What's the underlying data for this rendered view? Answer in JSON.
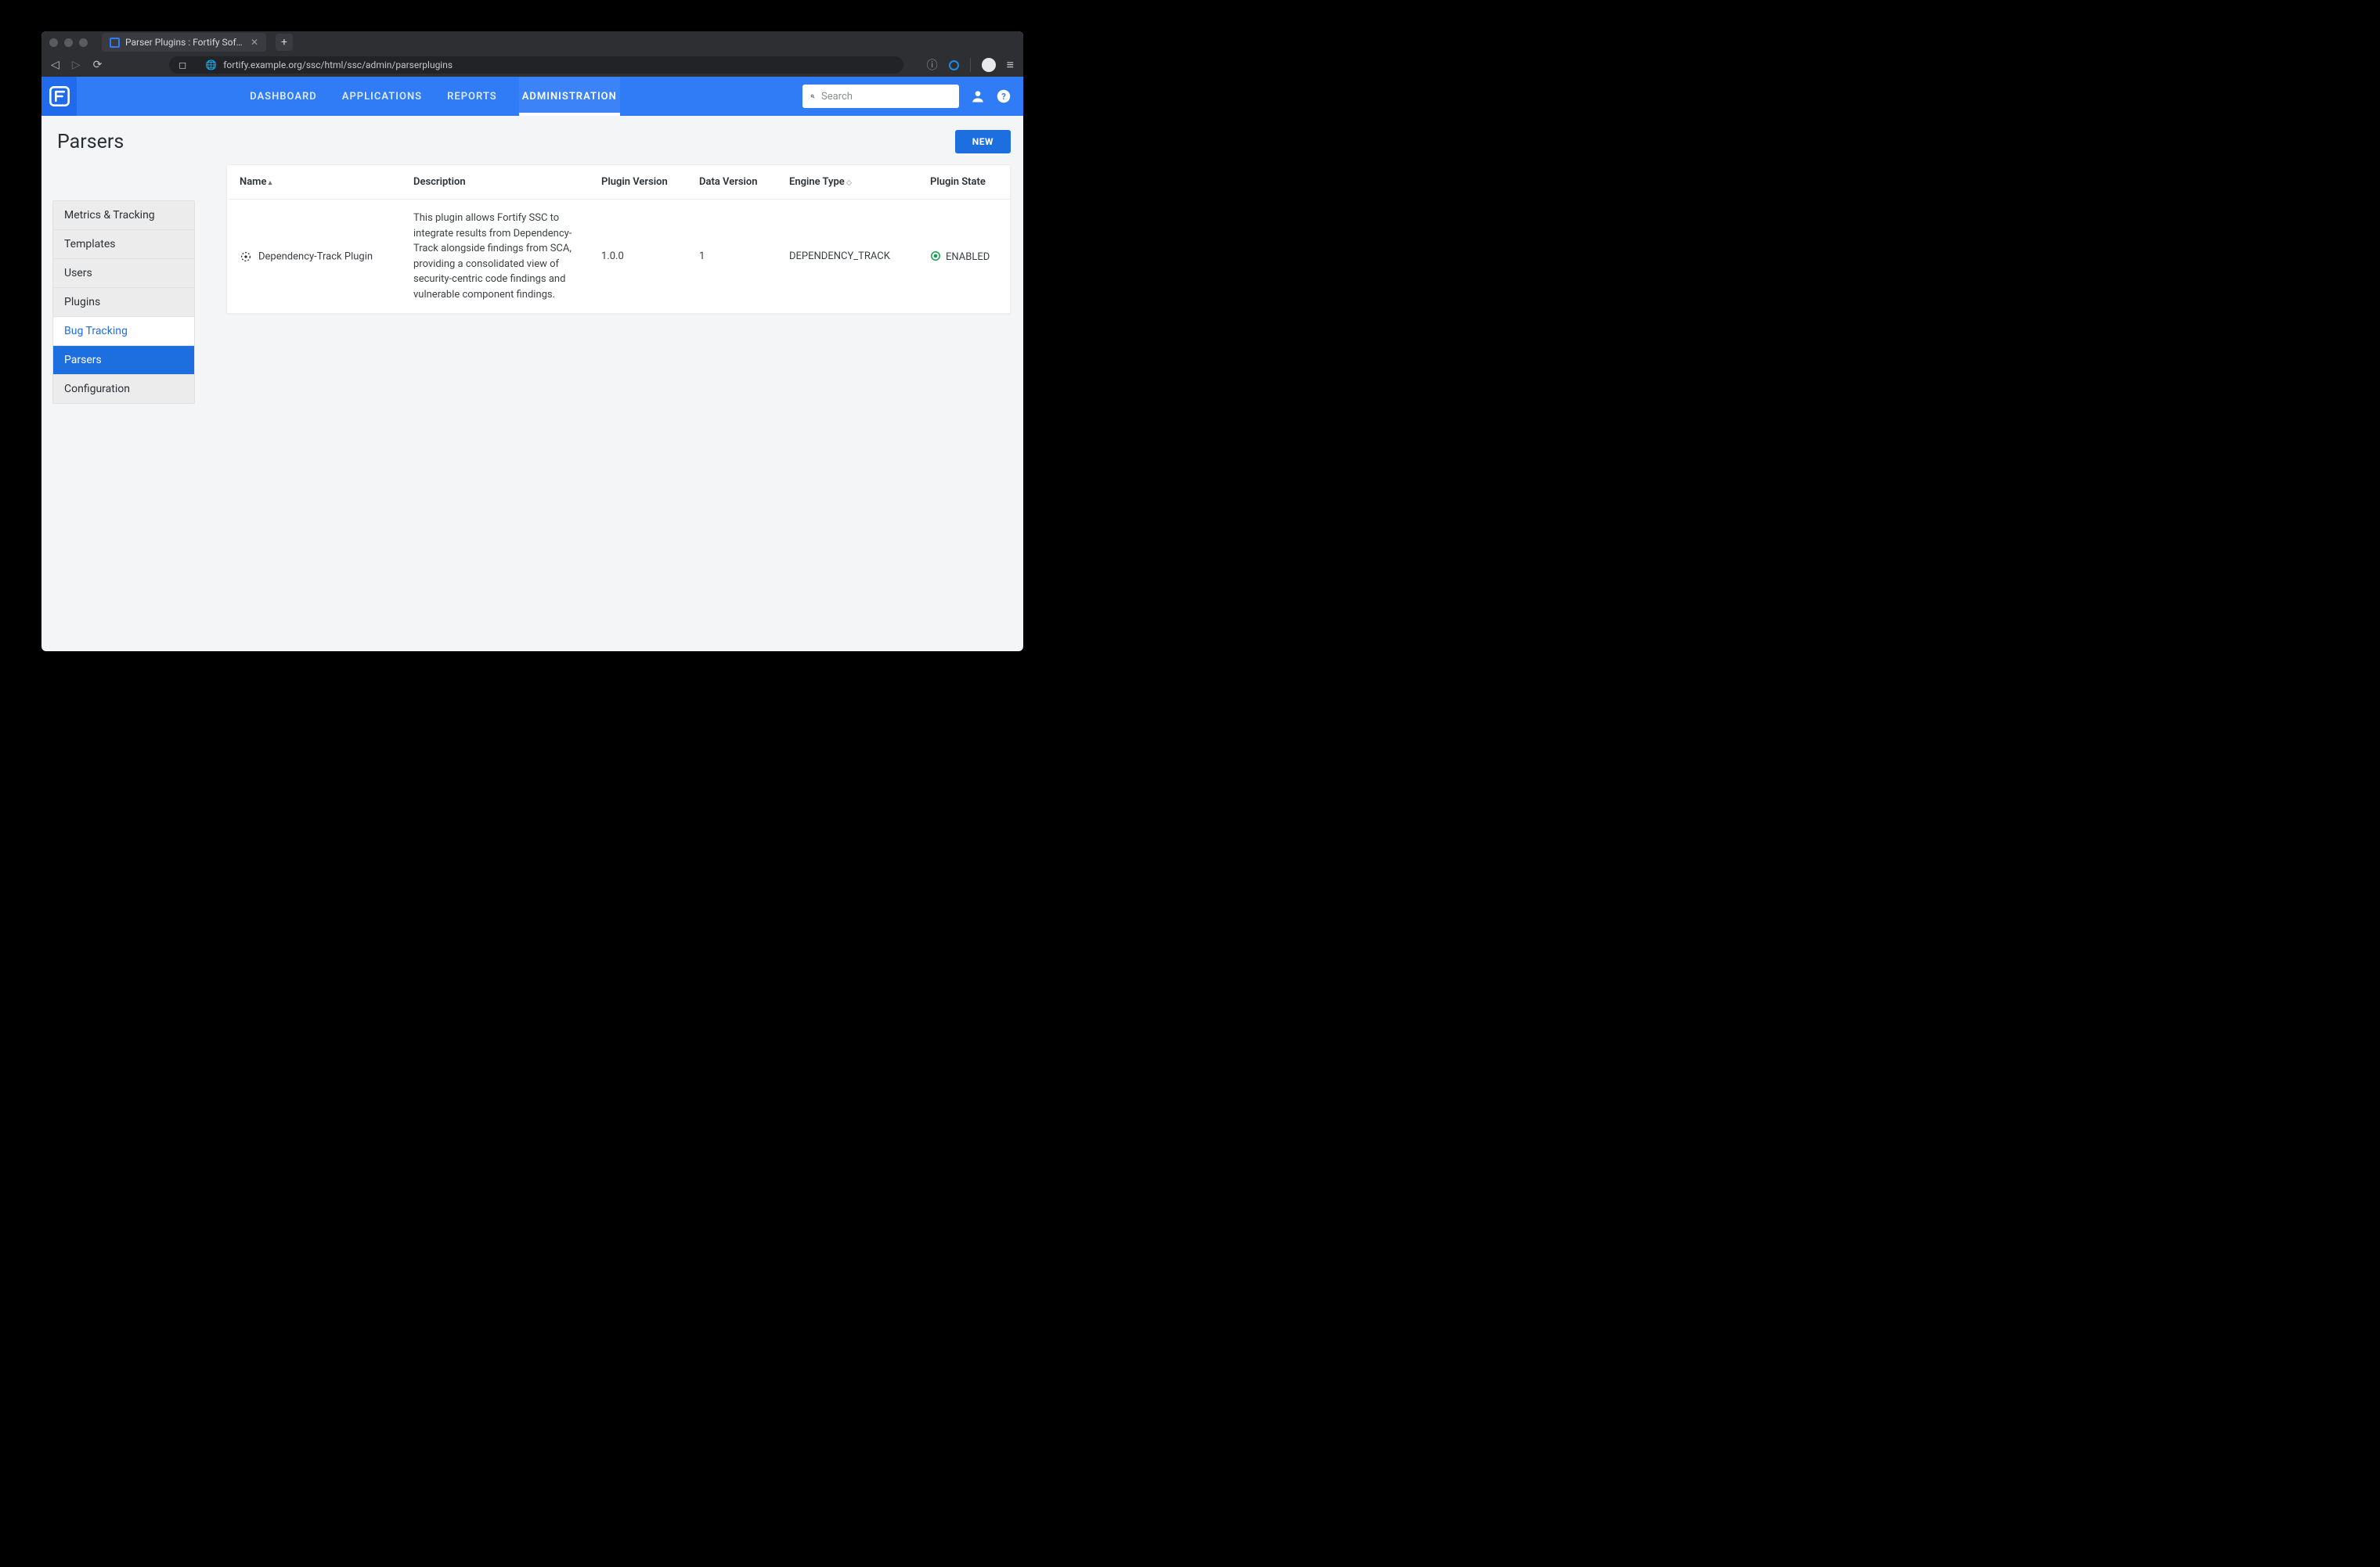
{
  "browser": {
    "tab_title": "Parser Plugins : Fortify Software",
    "url": "fortify.example.org/ssc/html/ssc/admin/parserplugins"
  },
  "header": {
    "nav": {
      "dashboard": "DASHBOARD",
      "applications": "APPLICATIONS",
      "reports": "REPORTS",
      "administration": "ADMINISTRATION"
    },
    "search_placeholder": "Search"
  },
  "page": {
    "title": "Parsers",
    "new_label": "NEW"
  },
  "sidebar": {
    "items": [
      {
        "label": "Metrics & Tracking"
      },
      {
        "label": "Templates"
      },
      {
        "label": "Users"
      },
      {
        "label": "Plugins"
      },
      {
        "label": "Bug Tracking"
      },
      {
        "label": "Parsers"
      },
      {
        "label": "Configuration"
      }
    ]
  },
  "table": {
    "cols": {
      "name": "Name",
      "description": "Description",
      "plugin_version": "Plugin Version",
      "data_version": "Data Version",
      "engine_type": "Engine Type",
      "plugin_state": "Plugin State"
    },
    "rows": [
      {
        "name": "Dependency-Track Plugin",
        "description": "This plugin allows Fortify SSC to integrate results from Dependency-Track alongside findings from SCA, providing a consolidated view of security-centric code findings and vulnerable component findings.",
        "plugin_version": "1.0.0",
        "data_version": "1",
        "engine_type": "DEPENDENCY_TRACK",
        "plugin_state": "ENABLED"
      }
    ]
  },
  "colors": {
    "state_enabled": "#12a04b"
  }
}
